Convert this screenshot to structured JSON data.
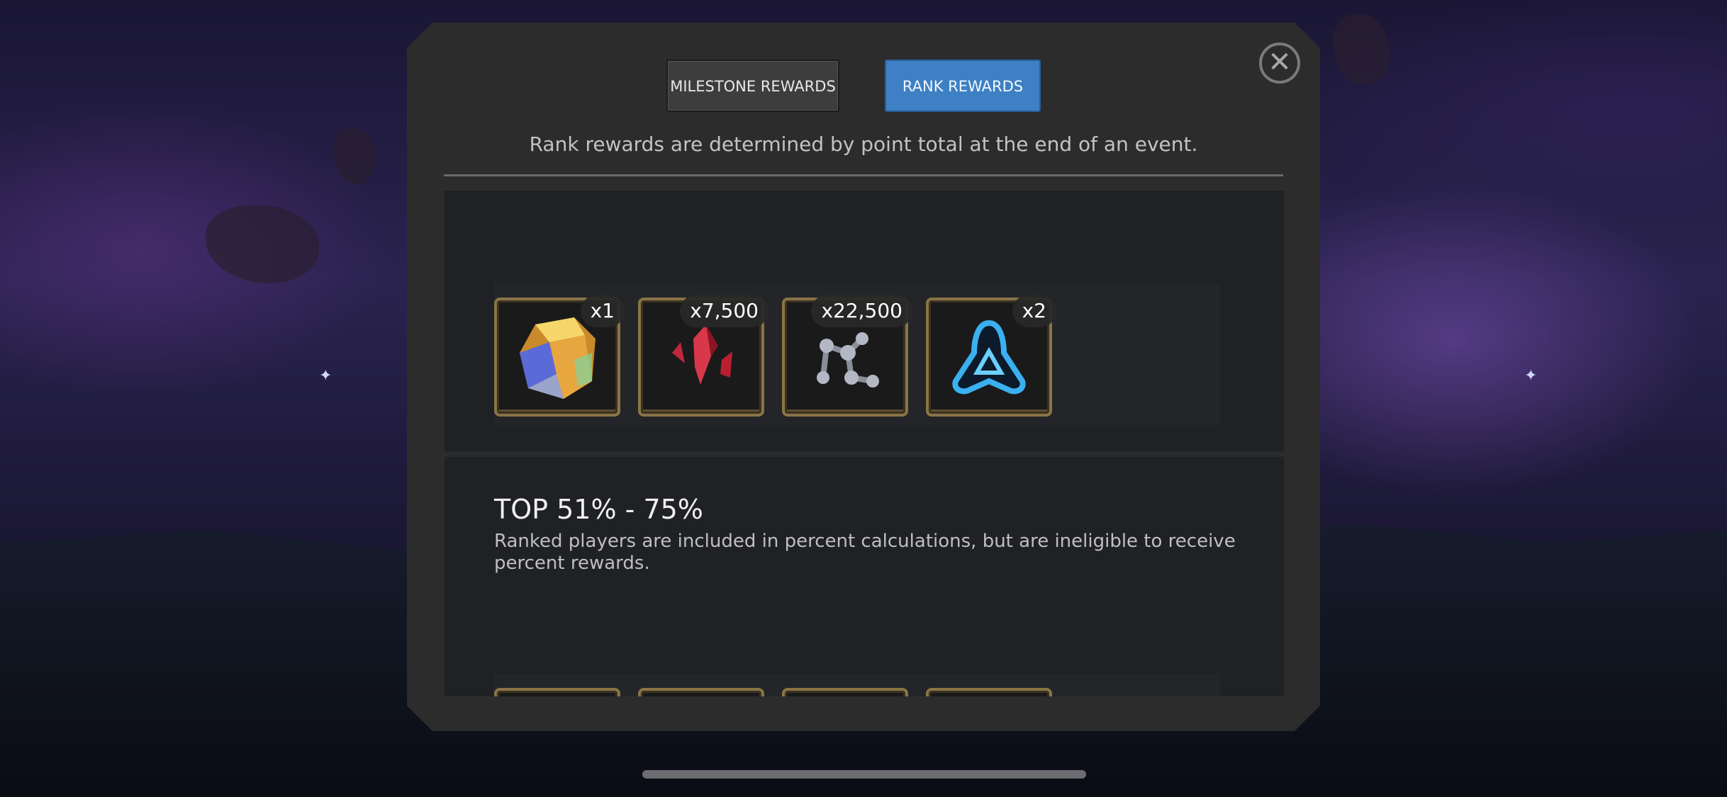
{
  "tabs": [
    {
      "label": "MILESTONE REWARDS",
      "active": false
    },
    {
      "label": "RANK REWARDS",
      "active": true
    }
  ],
  "close_icon": "close-circle-icon",
  "description": "Rank rewards are determined by point total at the end of an event.",
  "tiers": [
    {
      "title": "",
      "note": "",
      "rewards": [
        {
          "icon": "crystal-cube-icon",
          "quantity": "x1"
        },
        {
          "icon": "red-shard-icon",
          "quantity": "x7,500"
        },
        {
          "icon": "catalyst-fragment-icon",
          "quantity": "x22,500"
        },
        {
          "icon": "blue-catalyst-icon",
          "quantity": "x2"
        }
      ]
    },
    {
      "title": "TOP 51% - 75%",
      "note": "Ranked players are included in percent calculations, but are ineligible to receive percent rewards."
    }
  ],
  "colors": {
    "active_tab": "#3d80c4",
    "panel": "#2c2c2d",
    "item_frame": "#8a7446"
  }
}
